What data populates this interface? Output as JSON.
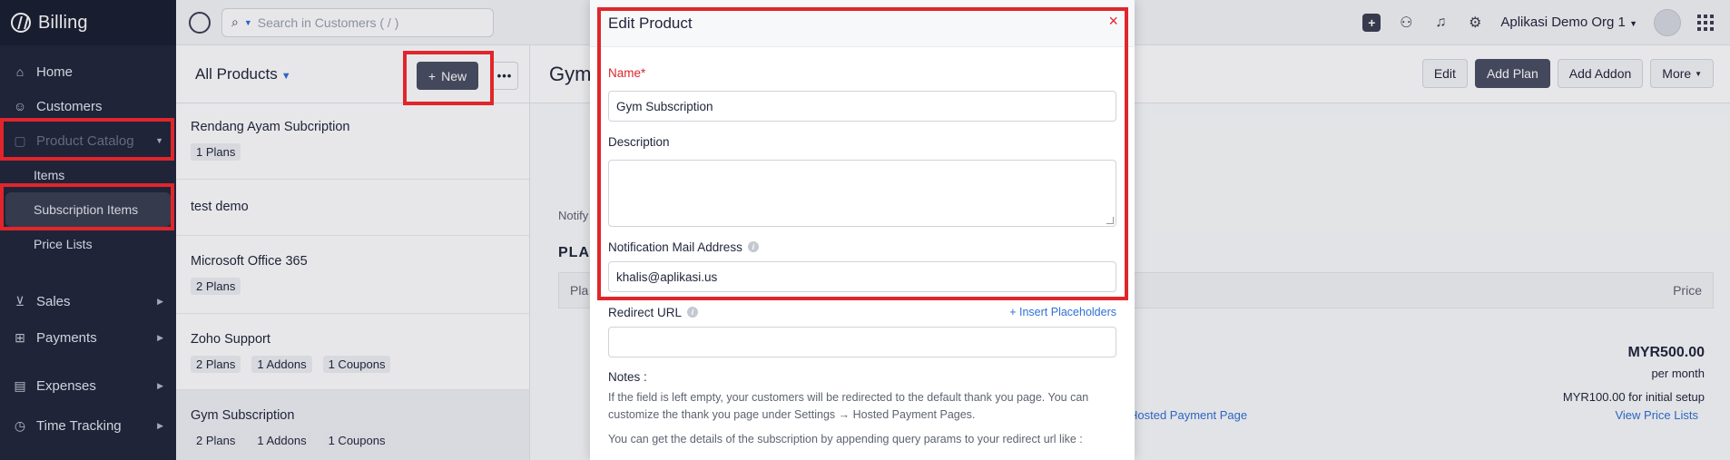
{
  "sidebar": {
    "brand": "Billing",
    "items": [
      {
        "label": "Home",
        "icon": "home-icon"
      },
      {
        "label": "Customers",
        "icon": "user-icon"
      },
      {
        "label": "Product Catalog",
        "icon": "box-icon"
      }
    ],
    "sub_items": [
      {
        "label": "Items"
      },
      {
        "label": "Subscription Items"
      },
      {
        "label": "Price Lists"
      }
    ],
    "groups": [
      {
        "label": "Sales",
        "icon": "cart-icon"
      },
      {
        "label": "Payments",
        "icon": "payments-icon"
      },
      {
        "label": "Expenses",
        "icon": "receipt-icon"
      },
      {
        "label": "Time Tracking",
        "icon": "clock-icon"
      }
    ]
  },
  "topbar": {
    "search_placeholder": "Search in Customers ( / )",
    "org_name": "Aplikasi Demo Org 1"
  },
  "list": {
    "title": "All Products",
    "new_label": "New",
    "products": [
      {
        "name": "Rendang Ayam Subcription",
        "badges": [
          "1 Plans"
        ]
      },
      {
        "name": "test demo",
        "badges": []
      },
      {
        "name": "Microsoft Office 365",
        "badges": [
          "2 Plans"
        ]
      },
      {
        "name": "Zoho Support",
        "badges": [
          "2 Plans",
          "1 Addons",
          "1 Coupons"
        ]
      },
      {
        "name": "Gym Subscription",
        "badges": [
          "2 Plans",
          "1 Addons",
          "1 Coupons"
        ]
      }
    ]
  },
  "detail": {
    "title": "Gym",
    "actions": [
      "Edit",
      "Add Plan",
      "Add Addon",
      "More"
    ],
    "notify_label": "Notify",
    "plans_label": "PLA",
    "table_col_first": "Pla",
    "table_col_price": "Price",
    "amount": "MYR500.00",
    "period": "per month",
    "setup": "MYR100.00 for initial setup",
    "hosted_link": "Hosted Payment Page",
    "pricelists_link": "View Price Lists"
  },
  "modal": {
    "title": "Edit Product",
    "close_glyph": "×",
    "name_label": "Name*",
    "name_value": "Gym Subscription",
    "description_label": "Description",
    "description_value": "",
    "notification_label": "Notification Mail Address",
    "notification_value": "khalis@aplikasi.us",
    "redirect_label": "Redirect URL",
    "redirect_value": "",
    "insert_placeholders": "+ Insert Placeholders",
    "notes_heading": "Notes :",
    "notes_text_1": "If the field is left empty, your customers will be redirected to the default thank you page. You can customize the thank you page under Settings → Hosted Payment Pages.",
    "notes_text_2": "You can get the details of the subscription by appending query params to your redirect url like :"
  },
  "colors": {
    "sidebar_bg": "#21263c",
    "highlight": "#e0262b",
    "link": "#2f6fd6",
    "primary_button": "#4a4f62"
  }
}
